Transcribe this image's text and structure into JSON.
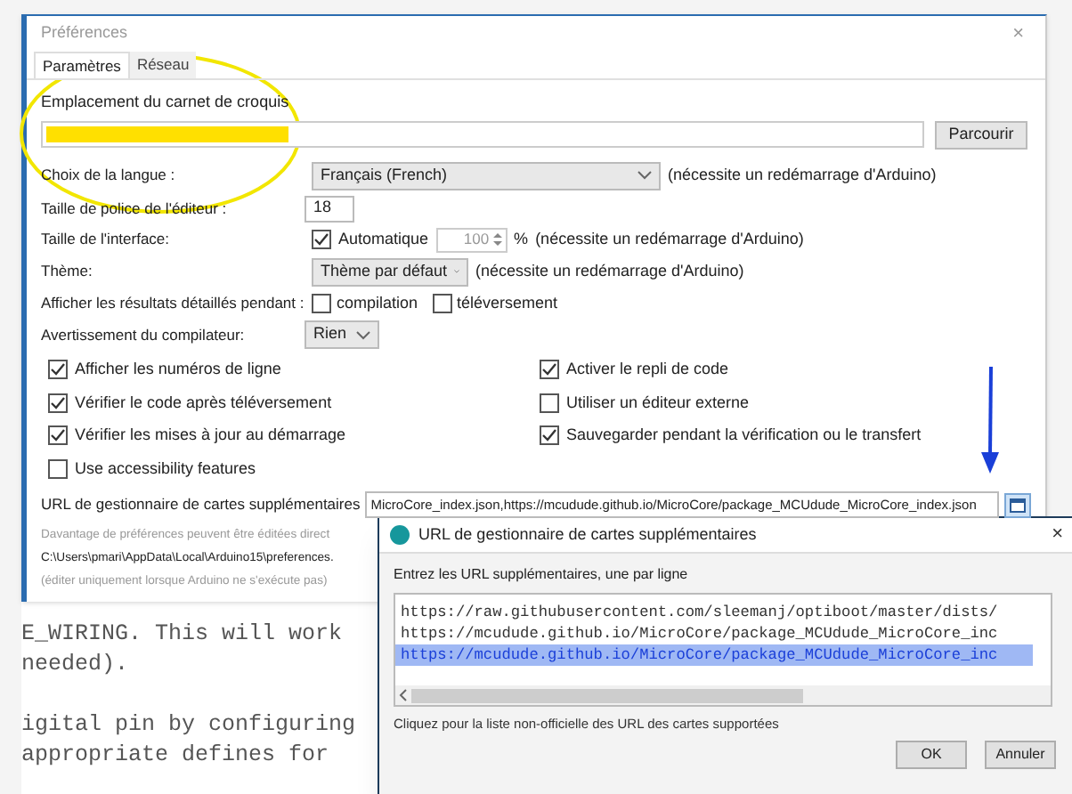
{
  "window": {
    "title": "Préférences",
    "close": "×"
  },
  "tabs": [
    {
      "label": "Paramètres",
      "selected": true
    },
    {
      "label": "Réseau",
      "selected": false
    }
  ],
  "sketchbook": {
    "label": "Emplacement du carnet de croquis",
    "button": "Parcourir"
  },
  "language": {
    "label": "Choix de la langue :",
    "value": "Français (French)",
    "note": "(nécessite un redémarrage d'Arduino)"
  },
  "font_size": {
    "label": "Taille de police de l'éditeur :",
    "value": "18"
  },
  "interface_scale": {
    "label": "Taille de l'interface:",
    "auto_label": "Automatique",
    "auto_checked": true,
    "value": "100",
    "unit": "%",
    "note": "(nécessite un redémarrage d'Arduino)"
  },
  "theme": {
    "label": "Thème:",
    "value": "Thème par défaut",
    "note": "(nécessite un redémarrage d'Arduino)"
  },
  "verbose": {
    "label": "Afficher les résultats détaillés pendant :",
    "options": [
      {
        "label": "compilation",
        "checked": false
      },
      {
        "label": "téléversement",
        "checked": false
      }
    ]
  },
  "compiler_warnings": {
    "label": "Avertissement du compilateur:",
    "value": "Rien"
  },
  "left_options": [
    {
      "label": "Afficher les numéros de ligne",
      "checked": true
    },
    {
      "label": "Vérifier le code après téléversement",
      "checked": true
    },
    {
      "label": "Vérifier les mises à jour au démarrage",
      "checked": true
    },
    {
      "label": "Use accessibility features",
      "checked": false
    }
  ],
  "right_options": [
    {
      "label": "Activer le repli de code",
      "checked": true
    },
    {
      "label": "Utiliser un éditeur externe",
      "checked": false
    },
    {
      "label": "Sauvegarder pendant la vérification ou le transfert",
      "checked": true
    }
  ],
  "board_urls": {
    "label": "URL de gestionnaire de cartes supplémentaires",
    "value": "MicroCore_index.json,https://mcudude.github.io/MicroCore/package_MCUdude_MicroCore_index.json"
  },
  "footer": {
    "more_text": "Davantage de préférences peuvent être éditées direct",
    "path": "C:\\Users\\pmari\\AppData\\Local\\Arduino15\\preferences.",
    "note": "(éditer uniquement lorsque Arduino ne s'exécute pas)"
  },
  "background_code": [
    "E_WIRING. This will work",
    "needed).",
    "igital pin by configuring",
    "appropriate defines for"
  ],
  "url_dialog": {
    "title": "URL de gestionnaire de cartes supplémentaires",
    "close": "×",
    "prompt": "Entrez les URL supplémentaires, une par ligne",
    "lines": [
      {
        "text": "https://raw.githubusercontent.com/sleemanj/optiboot/master/dists/",
        "selected": false
      },
      {
        "text": "https://mcudude.github.io/MicroCore/package_MCUdude_MicroCore_inc",
        "selected": false
      },
      {
        "text": "https://mcudude.github.io/MicroCore/package_MCUdude_MicroCore_inc",
        "selected": true
      }
    ],
    "link": "Cliquez pour la liste non-officielle des URL des cartes supportées",
    "buttons": [
      "OK",
      "Annuler"
    ]
  }
}
